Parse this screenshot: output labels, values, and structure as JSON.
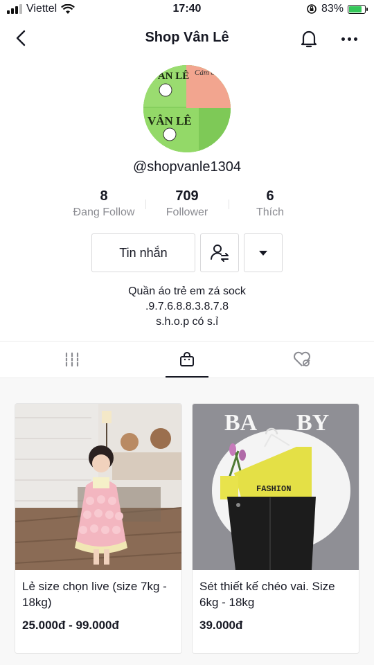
{
  "status_bar": {
    "carrier": "Viettel",
    "time": "17:40",
    "battery_percent": "83%",
    "battery_level": 0.83
  },
  "header": {
    "title": "Shop Vân Lê"
  },
  "profile": {
    "handle": "@shopvanle1304",
    "avatar_text_top": "VÂN LÊ",
    "avatar_text_bottom": "VÂN LÊ",
    "avatar_text_pink": "Cám ơn"
  },
  "stats": [
    {
      "value": "8",
      "label": "Đang Follow"
    },
    {
      "value": "709",
      "label": "Follower"
    },
    {
      "value": "6",
      "label": "Thích"
    }
  ],
  "actions": {
    "message_label": "Tin nhắn"
  },
  "bio": {
    "line1": "Quần áo trẻ em zá sock",
    "line2": ".9.7.6.8.8.3.8.7.8",
    "line3": "s.h.o.p có s.ỉ"
  },
  "tabs": [
    "videos",
    "shop",
    "liked"
  ],
  "products": [
    {
      "title": "Lẻ size chọn live (size 7kg - 18kg)",
      "price": "25.000đ - 99.000đ"
    },
    {
      "title": "Sét thiết kế chéo vai. Size 6kg - 18kg",
      "price": "39.000đ",
      "image_text_brand": "BA",
      "image_text_brand2": "BY",
      "image_text_shirt": "FASHION"
    }
  ],
  "colors": {
    "text": "#161823",
    "muted": "#8a8b91",
    "battery": "#34c759",
    "avatar_green": "#8fd46a",
    "avatar_pink": "#f2a58f"
  }
}
